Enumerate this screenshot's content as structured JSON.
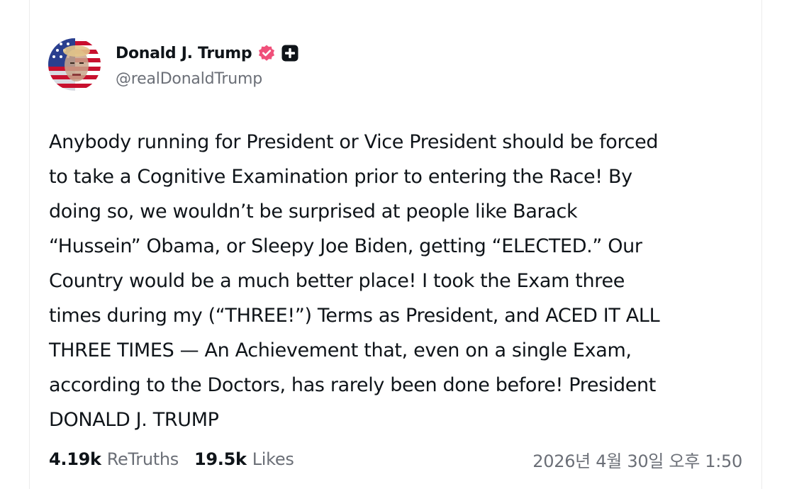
{
  "post": {
    "author": {
      "display_name": "Donald J. Trump",
      "handle": "@realDonaldTrump",
      "verified_color": "#f0507a"
    },
    "text": "Anybody running for President or Vice President should be forced\nto take a Cognitive Examination prior to entering the Race! By\ndoing so, we wouldn’t be surprised at people like Barack\n“Hussein” Obama, or Sleepy Joe Biden, getting “ELECTED.” Our\nCountry would be a much better place! I took the Exam three\ntimes during my (“THREE!”) Terms as President, and ACED IT ALL\nTHREE TIMES — An Achievement that, even on a single Exam,\naccording to the Doctors, has rarely been done before! President\nDONALD J. TRUMP",
    "stats": {
      "retruths_count": "4.19k",
      "retruths_label": "ReTruths",
      "likes_count": "19.5k",
      "likes_label": "Likes"
    },
    "timestamp": "2026년 4월 30일 오후 1:50"
  },
  "icons": {
    "verified": "verified-badge-icon",
    "plus": "plus-square-icon"
  }
}
